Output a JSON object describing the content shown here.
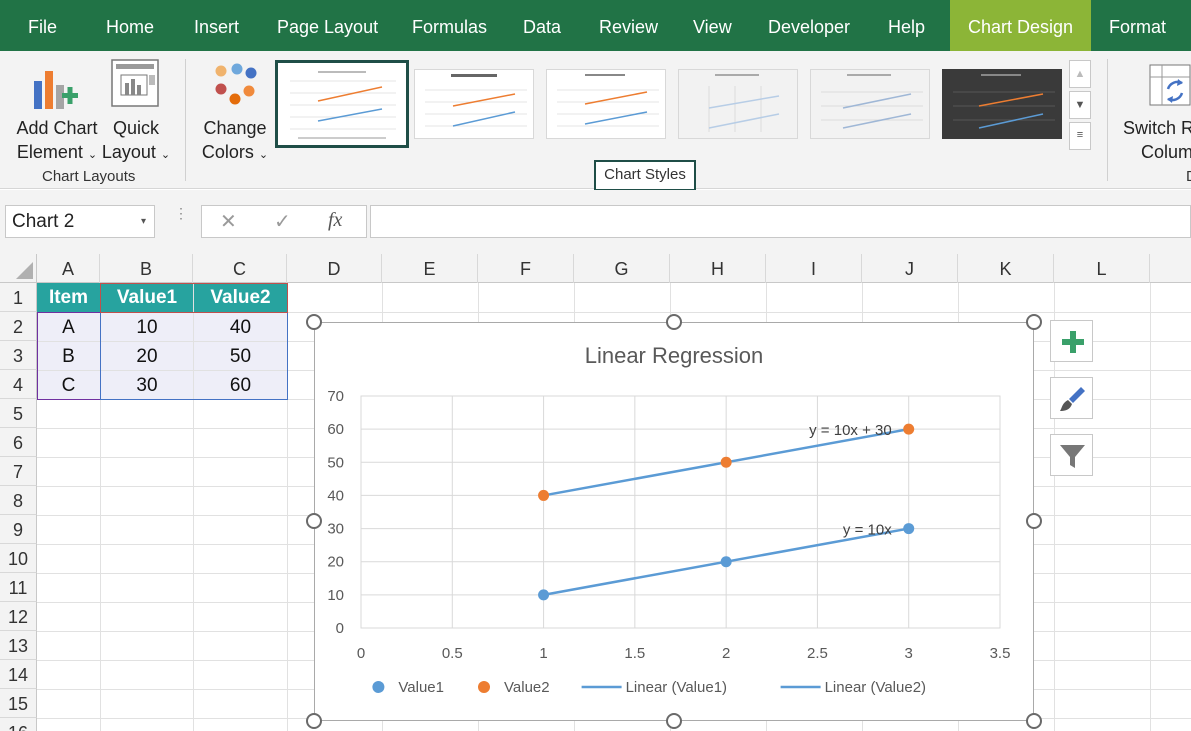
{
  "ribbon": {
    "tabs": [
      "File",
      "Home",
      "Insert",
      "Page Layout",
      "Formulas",
      "Data",
      "Review",
      "View",
      "Developer",
      "Help",
      "Chart Design",
      "Format"
    ],
    "active_tab": "Chart Design",
    "add_chart_element": [
      "Add Chart",
      "Element"
    ],
    "quick_layout": [
      "Quick",
      "Layout"
    ],
    "change_colors": [
      "Change",
      "Colors"
    ],
    "switch_row_col": [
      "Switch Ro",
      "Colum"
    ],
    "group_chart_layouts": "Chart Layouts",
    "group_chart_styles": "Chart Styles",
    "group_data_cut": "D"
  },
  "formula_bar": {
    "name_box": "Chart 2",
    "cancel_glyph": "✕",
    "enter_glyph": "✓",
    "fx_glyph": "fx",
    "value": ""
  },
  "sheet": {
    "columns": [
      "A",
      "B",
      "C",
      "D",
      "E",
      "F",
      "G",
      "H",
      "I",
      "J",
      "K",
      "L"
    ],
    "rows": [
      "1",
      "2",
      "3",
      "4",
      "5",
      "6",
      "7",
      "8",
      "9",
      "10",
      "11",
      "12",
      "13",
      "14",
      "15",
      "16"
    ],
    "table": {
      "headers": [
        "Item",
        "Value1",
        "Value2"
      ],
      "rows": [
        [
          "A",
          "10",
          "40"
        ],
        [
          "B",
          "20",
          "50"
        ],
        [
          "C",
          "30",
          "60"
        ]
      ]
    }
  },
  "chart_data": {
    "type": "scatter",
    "title": "Linear Regression",
    "xlabel": "",
    "ylabel": "",
    "xlim": [
      0,
      3.5
    ],
    "ylim": [
      0,
      70
    ],
    "x_ticks": [
      "0",
      "0.5",
      "1",
      "1.5",
      "2",
      "2.5",
      "3",
      "3.5"
    ],
    "y_ticks": [
      "0",
      "10",
      "20",
      "30",
      "40",
      "50",
      "60",
      "70"
    ],
    "grid": true,
    "legend_position": "bottom",
    "series": [
      {
        "name": "Value1",
        "x": [
          1,
          2,
          3
        ],
        "y": [
          10,
          20,
          30
        ],
        "color": "#5b9bd5"
      },
      {
        "name": "Value2",
        "x": [
          1,
          2,
          3
        ],
        "y": [
          40,
          50,
          60
        ],
        "color": "#ed7d31"
      }
    ],
    "trendlines": [
      {
        "name": "Linear (Value1)",
        "slope": 10,
        "intercept": 0,
        "x_range": [
          1,
          3
        ],
        "equation": "y = 10x",
        "color": "#5b9bd5"
      },
      {
        "name": "Linear (Value2)",
        "slope": 10,
        "intercept": 30,
        "x_range": [
          1,
          3
        ],
        "equation": "y = 10x + 30",
        "color": "#5b9bd5"
      }
    ]
  },
  "colors": {
    "ribbon_green": "#217346",
    "active_tab": "#8cb537",
    "table_header": "#27a39f"
  }
}
